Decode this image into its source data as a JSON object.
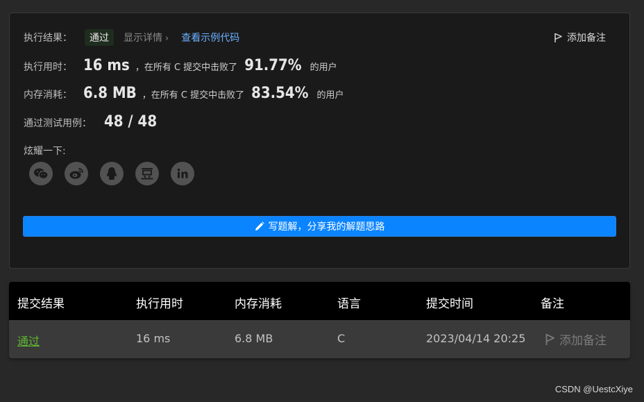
{
  "result": {
    "label": "执行结果：",
    "status": "通过",
    "detail_link": "显示详情",
    "example_link": "查看示例代码",
    "add_note": "添加备注"
  },
  "runtime": {
    "label": "执行用时：",
    "value": "16 ms",
    "mid": "，在所有 C 提交中击败了",
    "percent": "91.77%",
    "suffix": "的用户"
  },
  "memory": {
    "label": "内存消耗：",
    "value": "6.8 MB",
    "mid": "，在所有 C 提交中击败了",
    "percent": "83.54%",
    "suffix": "的用户"
  },
  "tests": {
    "label": "通过测试用例：",
    "value": "48 / 48"
  },
  "share": {
    "label": "炫耀一下:",
    "icons": [
      "wechat-icon",
      "weibo-icon",
      "qq-icon",
      "douban-icon",
      "linkedin-icon"
    ]
  },
  "write_solution": "写题解，分享我的解题思路",
  "table": {
    "headers": [
      "提交结果",
      "执行用时",
      "内存消耗",
      "语言",
      "提交时间",
      "备注"
    ],
    "row": {
      "result": "通过",
      "runtime": "16 ms",
      "memory": "6.8 MB",
      "language": "C",
      "time": "2023/04/14 20:25",
      "note": "添加备注"
    }
  },
  "watermark": "CSDN @UestcXiye",
  "colors": {
    "accent": "#0a84ff",
    "pass": "#5fb832",
    "link": "#6ab0ff"
  }
}
